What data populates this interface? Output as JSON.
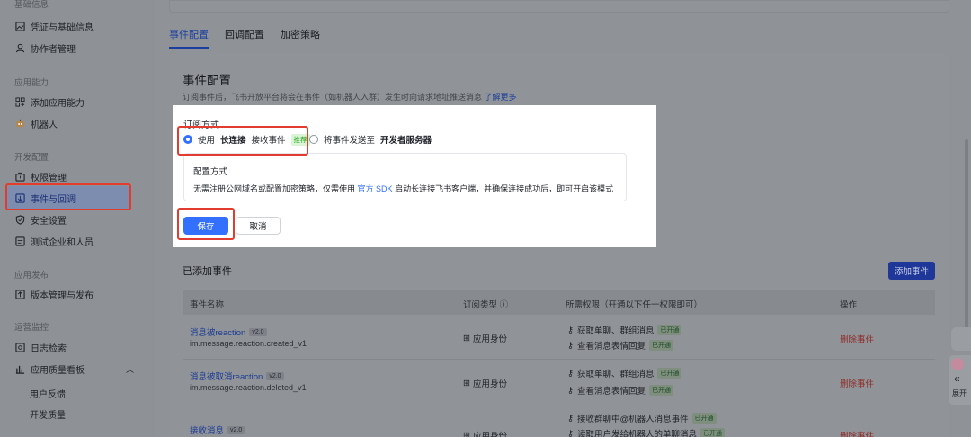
{
  "sidebar": {
    "sections": [
      {
        "title": "基础信息"
      },
      {
        "title": "应用能力"
      },
      {
        "title": "开发配置"
      },
      {
        "title": "应用发布"
      },
      {
        "title": "运营监控"
      }
    ],
    "items": {
      "credentials": "凭证与基础信息",
      "collaborators": "协作者管理",
      "add_capability": "添加应用能力",
      "bot": "机器人",
      "permissions": "权限管理",
      "events": "事件与回调",
      "security": "安全设置",
      "test_org": "测试企业和人员",
      "version": "版本管理与发布",
      "logs": "日志检索",
      "quality": "应用质量看板",
      "feedback": "用户反馈",
      "dev_quality": "开发质量"
    }
  },
  "tabs": [
    "事件配置",
    "回调配置",
    "加密策略"
  ],
  "panel": {
    "title": "事件配置",
    "desc": "订阅事件后，飞书开放平台将会在事件（如机器人入群）发生时向请求地址推送消息",
    "desc_link": "了解更多"
  },
  "popup": {
    "sub_label": "订阅方式",
    "option1_prefix": "使用",
    "option1_bold": "长连接",
    "option1_suffix": "接收事件",
    "option1_badge": "推荐",
    "option2_prefix": "将事件发送至",
    "option2_bold": "开发者服务器",
    "config_title": "配置方式",
    "config_desc_prefix": "无需注册公网域名或配置加密策略，仅需使用",
    "config_desc_link": "官方 SDK",
    "config_desc_suffix": "启动长连接飞书客户端，并确保连接成功后，即可开启该模式",
    "save": "保存",
    "cancel": "取消"
  },
  "added": {
    "title": "已添加事件",
    "add_button": "添加事件",
    "headers": {
      "name": "事件名称",
      "sub_type": "订阅类型 ⓘ",
      "perm": "所需权限（开通以下任一权限即可）",
      "action": "操作"
    },
    "rows": [
      {
        "name": "消息被reaction",
        "ver": "v2.0",
        "code": "im.message.reaction.created_v1",
        "sub_type": "应用身份",
        "perm1": "获取单聊、群组消息",
        "perm1_badge": "已开通",
        "perm2": "查看消息表情回复",
        "perm2_badge": "已开通",
        "action": "删除事件"
      },
      {
        "name": "消息被取消reaction",
        "ver": "v2.0",
        "code": "im.message.reaction.deleted_v1",
        "sub_type": "应用身份",
        "perm1": "获取单聊、群组消息",
        "perm1_badge": "已开通",
        "perm2": "查看消息表情回复",
        "perm2_badge": "已开通",
        "action": "删除事件"
      },
      {
        "name": "接收消息",
        "ver": "v2.0",
        "sub_type": "应用身份",
        "perm1": "接收群聊中@机器人消息事件",
        "perm1_badge": "已开通",
        "perm2": "读取用户发给机器人的单聊消息",
        "perm2_badge": "已开通",
        "action": "删除事件"
      }
    ]
  },
  "right": {
    "expand": "展开"
  },
  "colors": {
    "accent": "#3370ff",
    "highlight": "#e23b2f",
    "badge_green": "#2ea121"
  }
}
